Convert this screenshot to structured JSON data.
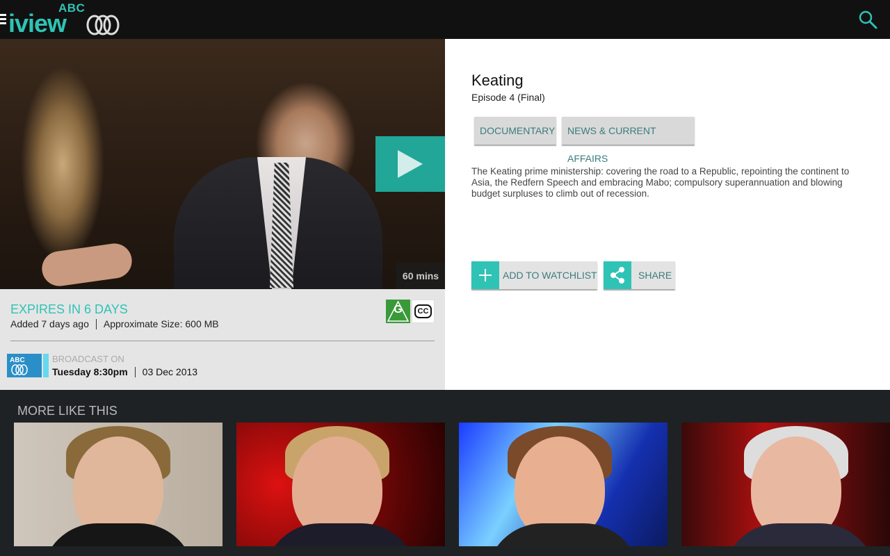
{
  "header": {
    "logo_abc": "ABC",
    "logo_iview": "iview",
    "colors": {
      "brand": "#2fc3b5",
      "bar": "#111111"
    }
  },
  "hero": {
    "duration": "60 mins"
  },
  "info": {
    "expires": "EXPIRES IN 6 DAYS",
    "added": "Added 7 days ago",
    "size": "Approximate Size: 600 MB",
    "rating": "G",
    "cc": "CC",
    "broadcast_label": "BROADCAST ON",
    "broadcast_time": "Tuesday 8:30pm",
    "broadcast_date": "03 Dec 2013",
    "channel_logo": "ABC"
  },
  "detail": {
    "title": "Keating",
    "episode": "Episode 4 (Final)",
    "tags": [
      "DOCUMENTARY",
      "NEWS & CURRENT AFFAIRS"
    ],
    "description": "The Keating prime ministership: covering the road to a Republic, repointing the continent to Asia, the Redfern Speech and embracing Mabo; compulsory superannuation and blowing budget surpluses to climb out of recession.",
    "actions": {
      "watchlist": "ADD TO WATCHLIST",
      "share": "SHARE"
    }
  },
  "more": {
    "title": "MORE LIKE THIS"
  }
}
